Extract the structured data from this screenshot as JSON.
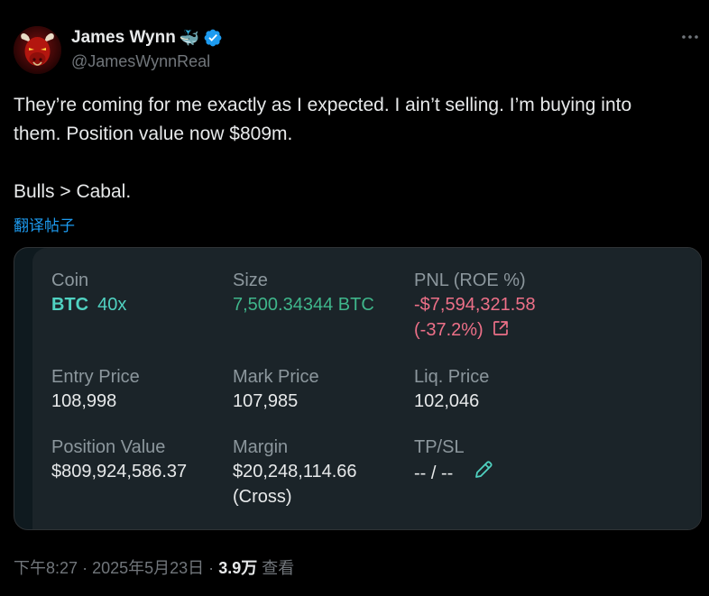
{
  "author": {
    "name": "James Wynn",
    "emoji": "🐳",
    "handle": "@JamesWynnReal",
    "verified": true
  },
  "tweet": {
    "paragraphs": [
      "They’re coming for me exactly as I expected. I ain’t selling. I’m buying into them. Position value now $809m.",
      "Bulls > Cabal."
    ],
    "translate_link": "翻译帖子"
  },
  "position_card": {
    "coin": {
      "label": "Coin",
      "symbol": "BTC",
      "leverage": "40x"
    },
    "size": {
      "label": "Size",
      "value": "7,500.34344 BTC"
    },
    "pnl": {
      "label": "PNL (ROE %)",
      "value": "-$7,594,321.58",
      "roe": "(-37.2%)"
    },
    "entry_price": {
      "label": "Entry Price",
      "value": "108,998"
    },
    "mark_price": {
      "label": "Mark Price",
      "value": "107,985"
    },
    "liq_price": {
      "label": "Liq. Price",
      "value": "102,046"
    },
    "position_value": {
      "label": "Position Value",
      "value": "$809,924,586.37"
    },
    "margin": {
      "label": "Margin",
      "value": "$20,248,114.66",
      "mode": "(Cross)"
    },
    "tpsl": {
      "label": "TP/SL",
      "value": "-- / --"
    }
  },
  "footer": {
    "time": "下午8:27",
    "separator": "·",
    "date": "2025年5月23日",
    "views_count": "3.9万",
    "views_label": "查看"
  },
  "icons": {
    "more": "more-horizontal-icon",
    "verified": "verified-badge-icon",
    "external_link": "external-link-icon",
    "edit": "pencil-edit-icon"
  },
  "colors": {
    "background": "#000000",
    "text_primary": "#e7e9ea",
    "text_secondary": "#71767b",
    "link": "#1d9bf0",
    "verified": "#1d9bf0",
    "card_bg": "#1b2429",
    "profit_green": "#50d2c1",
    "size_green": "#3fb68b",
    "loss_red": "#ed7088"
  }
}
